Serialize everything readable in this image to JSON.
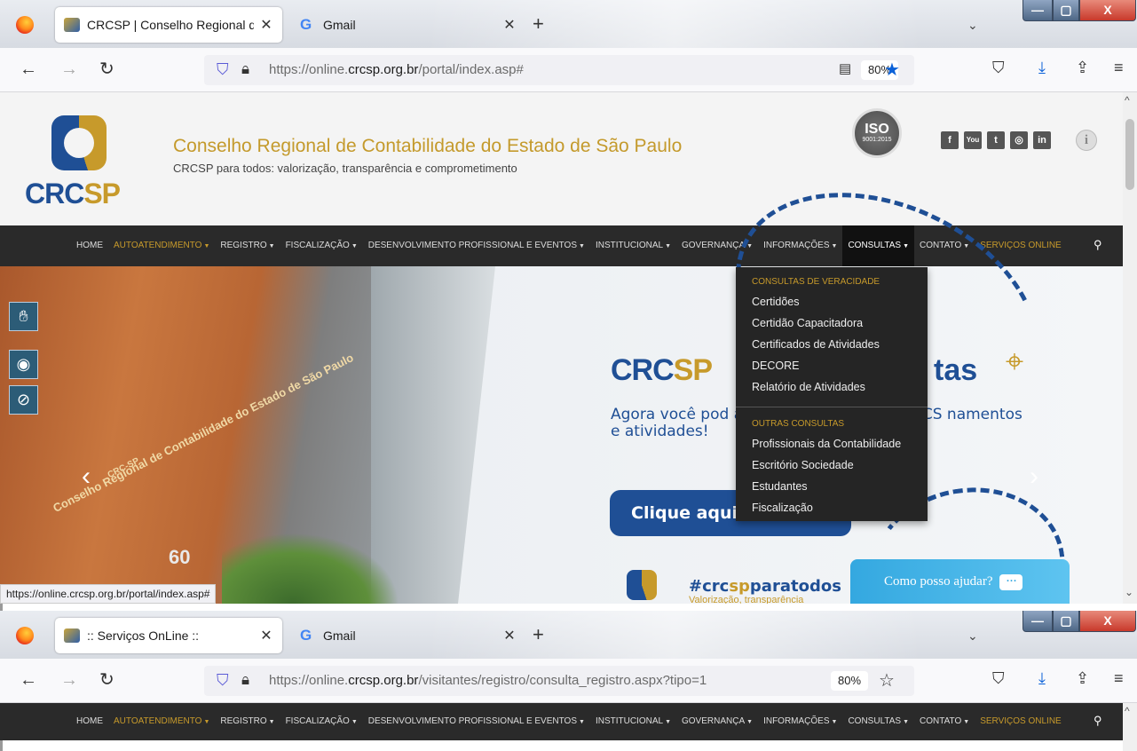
{
  "window1": {
    "tabs": [
      {
        "title": "CRCSP | Conselho Regional de Contabilidade",
        "close": "✕"
      },
      {
        "title": "Gmail",
        "close": "✕"
      }
    ],
    "new_tab": "+",
    "tabs_dropdown": "⌄",
    "url": {
      "prefix": "https://online.",
      "domain": "crcsp.org.br",
      "path": "/portal/index.asp#"
    },
    "zoom": "80%",
    "bookmarked": true,
    "status_url": "https://online.crcsp.org.br/portal/index.asp#"
  },
  "window2": {
    "tabs": [
      {
        "title": ":: Serviços OnLine ::",
        "close": "✕"
      },
      {
        "title": "Gmail",
        "close": "✕"
      }
    ],
    "new_tab": "+",
    "tabs_dropdown": "⌄",
    "url": {
      "prefix": "https://online.",
      "domain": "crcsp.org.br",
      "path": "/visitantes/registro/consulta_registro.aspx?tipo=1"
    },
    "zoom": "80%",
    "bookmarked": false
  },
  "window_controls": {
    "minimize": "—",
    "maximize": "▢",
    "close": "X"
  },
  "site": {
    "logo_text_a": "CRC",
    "logo_text_b": "SP",
    "title": "Conselho Regional de Contabilidade do Estado de São Paulo",
    "subtitle": "CRCSP para todos: valorização, transparência e comprometimento",
    "iso_label": "ISO",
    "iso_sub": "9001:2015",
    "social": [
      "f",
      "You",
      "t",
      "◎",
      "in"
    ],
    "info": "i"
  },
  "menu": [
    {
      "label": "HOME",
      "caret": false,
      "style": "normal"
    },
    {
      "label": "AUTOATENDIMENTO",
      "caret": true,
      "style": "gold"
    },
    {
      "label": "REGISTRO",
      "caret": true,
      "style": "normal"
    },
    {
      "label": "FISCALIZAÇÃO",
      "caret": true,
      "style": "normal"
    },
    {
      "label": "DESENVOLVIMENTO PROFISSIONAL E EVENTOS",
      "caret": true,
      "style": "normal"
    },
    {
      "label": "INSTITUCIONAL",
      "caret": true,
      "style": "normal"
    },
    {
      "label": "GOVERNANÇA",
      "caret": true,
      "style": "normal"
    },
    {
      "label": "INFORMAÇÕES",
      "caret": true,
      "style": "normal"
    },
    {
      "label": "CONSULTAS",
      "caret": true,
      "style": "active"
    },
    {
      "label": "CONTATO",
      "caret": true,
      "style": "normal"
    },
    {
      "label": "SERVIÇOS ONLINE",
      "caret": false,
      "style": "gold"
    }
  ],
  "dropdown": {
    "section1": "CONSULTAS DE VERACIDADE",
    "items1": [
      "Certidões",
      "Certidão Capacitadora",
      "Certificados de Atividades",
      "DECORE",
      "Relatório de Atividades"
    ],
    "section2": "OUTRAS CONSULTAS",
    "items2": [
      "Profissionais da Contabilidade",
      "Escritório Sociedade",
      "Estudantes",
      "Fiscalização"
    ]
  },
  "hero": {
    "title_a": "CRC",
    "title_b": "SP",
    "title_c": "tas",
    "text": "Agora você pod                          artilhados na sede do CRCS                       namentos e atividades!",
    "button": "Clique aqui e",
    "tag_a": "#crc",
    "tag_b": "sp",
    "tag_c": "paratodos",
    "tag_sub": "Valorização, transparência",
    "chat": "Como posso ajudar?",
    "sign": "Conselho Regional de Contabilidade do Estado de São Paulo",
    "sign2": "CRC-SP",
    "number": "60"
  },
  "colors": {
    "gold": "#c79a2b",
    "blue": "#1f4f95",
    "menubar": "#2a2a2a"
  }
}
